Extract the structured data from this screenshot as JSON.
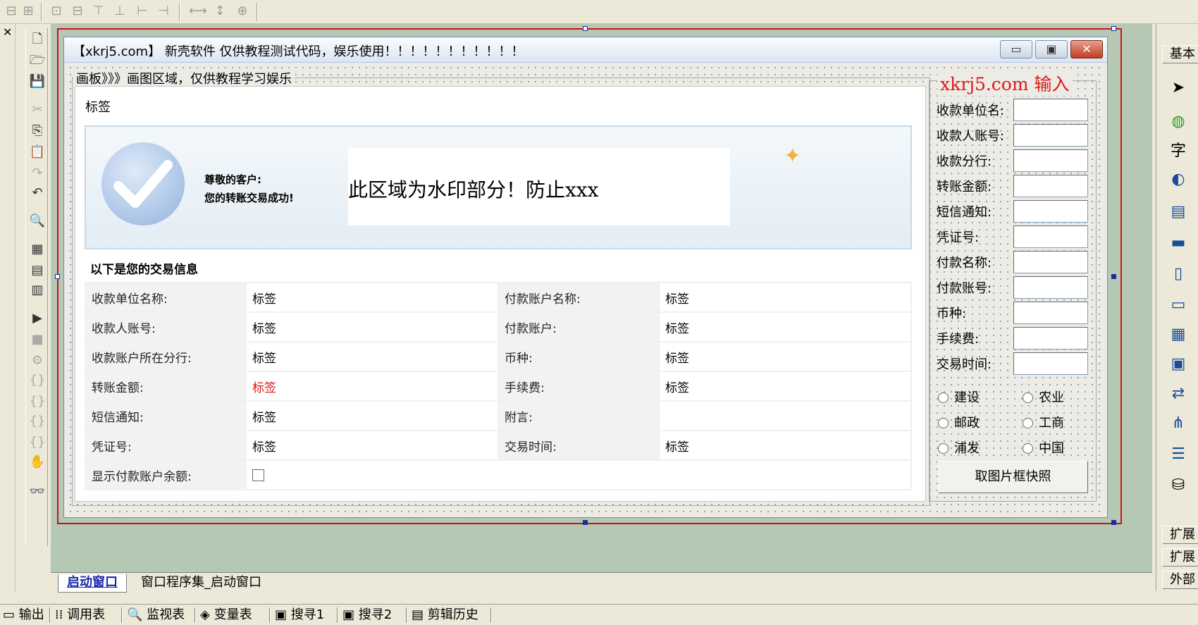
{
  "window": {
    "title": "【xkrj5.com】 新壳软件 仅供教程测试代码，娱乐使用！！！！！！！！！！！",
    "minimize_glyph": "▭",
    "restore_glyph": "▣",
    "close_glyph": "✕"
  },
  "board": {
    "group_title": "画板》》》画图区域，仅供教程学习娱乐",
    "label": "标签"
  },
  "banner": {
    "greeting": "尊敬的客户:",
    "success": "您的转账交易成功!",
    "watermark_text": "此区域为水印部分！防止xxx"
  },
  "section_title": "以下是您的交易信息",
  "table": {
    "rows": [
      {
        "l1": "收款单位名称:",
        "v1": "标签",
        "l2": "付款账户名称:",
        "v2": "标签"
      },
      {
        "l1": "收款人账号:",
        "v1": "标签",
        "l2": "付款账户:",
        "v2": "标签"
      },
      {
        "l1": "收款账户所在分行:",
        "v1": "标签",
        "l2": "币种:",
        "v2": "标签"
      },
      {
        "l1": "转账金额:",
        "v1": "标签",
        "l2": "手续费:",
        "v2": "标签"
      },
      {
        "l1": "短信通知:",
        "v1": "标签",
        "l2": "附言:",
        "v2": ""
      },
      {
        "l1": "凭证号:",
        "v1": "标签",
        "l2": "交易时间:",
        "v2": "标签"
      },
      {
        "l1": "显示付款账户余额:"
      }
    ],
    "highlight_color": "#e01010"
  },
  "input_panel": {
    "title": "xkrj5.com 输入",
    "fields": [
      {
        "label": "收款单位名:",
        "value": ""
      },
      {
        "label": "收款人账号:",
        "value": ""
      },
      {
        "label": "收款分行:",
        "value": ""
      },
      {
        "label": "转账金额:",
        "value": ""
      },
      {
        "label": "短信通知:",
        "value": ""
      },
      {
        "label": "凭证号:",
        "value": ""
      },
      {
        "label": "付款名称:",
        "value": ""
      },
      {
        "label": "付款账号:",
        "value": ""
      },
      {
        "label": "币种:",
        "value": ""
      },
      {
        "label": "手续费:",
        "value": ""
      },
      {
        "label": "交易时间:",
        "value": ""
      }
    ],
    "banks": [
      "建设",
      "农业",
      "邮政",
      "工商",
      "浦发",
      "中国"
    ],
    "snapshot_button": "取图片框快照"
  },
  "right_panel": {
    "tab": "基本",
    "ext1": "扩展",
    "ext2": "扩展",
    "ext3": "外部"
  },
  "doc_tabs": [
    "启动窗口",
    "窗口程序集_启动窗口"
  ],
  "bottom_tabs": [
    "输出",
    "调用表",
    "监视表",
    "变量表",
    "搜寻1",
    "搜寻2",
    "剪辑历史"
  ],
  "colors": {
    "accent_red": "#d0101a",
    "input_title_red": "#e01818",
    "form_bg": "#ecebe6",
    "design_bg": "#b4c8b4"
  }
}
